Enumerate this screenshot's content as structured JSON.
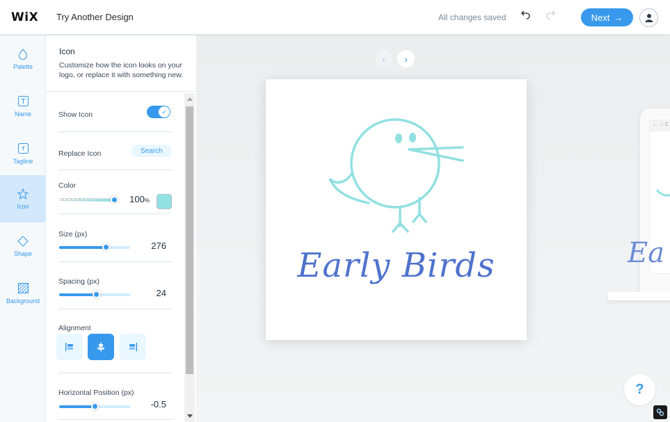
{
  "header": {
    "logo": "WiX",
    "try_another_design": "Try Another Design",
    "save_status": "All changes saved",
    "undo_icon": "undo-icon",
    "redo_icon": "redo-icon",
    "next_label": "Next",
    "next_arrow": "→",
    "account_icon": "user-icon"
  },
  "rail": {
    "items": [
      {
        "label": "Palette",
        "icon": "droplet-icon",
        "active": false
      },
      {
        "label": "Name",
        "icon": "text-box-icon",
        "active": false
      },
      {
        "label": "Tagline",
        "icon": "small-text-box-icon",
        "active": false
      },
      {
        "label": "Icon",
        "icon": "star-icon",
        "active": true
      },
      {
        "label": "Shape",
        "icon": "diamond-icon",
        "active": false
      },
      {
        "label": "Background",
        "icon": "hatched-square-icon",
        "active": false
      }
    ]
  },
  "panel": {
    "title": "Icon",
    "description": "Customize how the icon looks on your logo, or replace it with something new.",
    "show_icon": {
      "label": "Show Icon",
      "enabled": true
    },
    "replace_icon": {
      "label": "Replace Icon",
      "button": "Search"
    },
    "color": {
      "label": "Color",
      "opacity_value": "100",
      "opacity_unit": "%",
      "opacity_fraction": 1.0,
      "swatch": "#92e0e1"
    },
    "size": {
      "label": "Size (px)",
      "value": "276",
      "fraction": 0.66
    },
    "spacing": {
      "label": "Spacing (px)",
      "value": "24",
      "fraction": 0.52
    },
    "alignment": {
      "label": "Alignment",
      "options": [
        "left",
        "center",
        "right"
      ],
      "selected": "center"
    },
    "horizontal_position": {
      "label": "Horizontal Position (px)",
      "value": "-0.5",
      "fraction": 0.5
    }
  },
  "stage": {
    "prev_arrow": "‹",
    "next_arrow": "›",
    "logo_name": "Early Birds",
    "icon_color": "#92e0e1",
    "name_color": "#4f73cc",
    "laptop_preview_text": "Ea",
    "laptop_browser_bar": "← → C",
    "help_label": "?"
  },
  "colors": {
    "accent": "#3899ec",
    "rail_active": "#d3e9fb"
  }
}
